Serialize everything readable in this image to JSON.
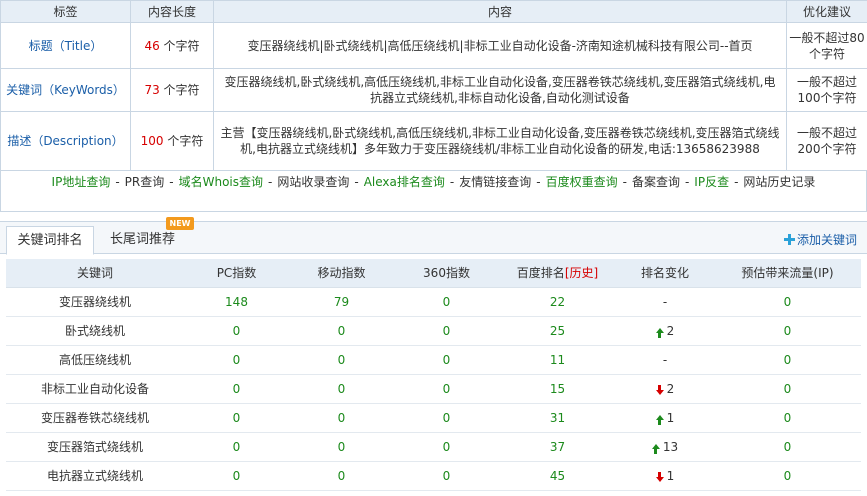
{
  "meta": {
    "headers": [
      "标签",
      "内容长度",
      "内容",
      "优化建议"
    ],
    "length_unit": "个字符",
    "rows": [
      {
        "label": "标题（Title）",
        "length": "46",
        "content": "变压器绕线机|卧式绕线机|高低压绕线机|非标工业自动化设备-济南知途机械科技有限公司--首页",
        "advice": "一般不超过80个字符"
      },
      {
        "label": "关键词（KeyWords）",
        "length": "73",
        "content": "变压器绕线机,卧式绕线机,高低压绕线机,非标工业自动化设备,变压器卷铁芯绕线机,变压器箔式绕线机,电抗器立式绕线机,非标自动化设备,自动化测试设备",
        "advice": "一般不超过100个字符"
      },
      {
        "label": "描述（Description）",
        "length": "100",
        "content": "主营【变压器绕线机,卧式绕线机,高低压绕线机,非标工业自动化设备,变压器卷铁芯绕线机,变压器箔式绕线机,电抗器立式绕线机】多年致力于变压器绕线机/非标工业自动化设备的研发,电话:13658623988",
        "advice": "一般不超过200个字符"
      }
    ]
  },
  "links": [
    {
      "text": "IP地址查询",
      "color": "green"
    },
    {
      "text": "PR查询",
      "color": "dark"
    },
    {
      "text": "域名Whois查询",
      "color": "green"
    },
    {
      "text": "网站收录查询",
      "color": "dark"
    },
    {
      "text": "Alexa排名查询",
      "color": "green"
    },
    {
      "text": "友情链接查询",
      "color": "dark"
    },
    {
      "text": "百度权重查询",
      "color": "green"
    },
    {
      "text": "备案查询",
      "color": "dark"
    },
    {
      "text": "IP反查",
      "color": "green"
    },
    {
      "text": "网站历史记录",
      "color": "dark"
    }
  ],
  "link_separator": "-",
  "tabs": {
    "active": "关键词排名",
    "second": "长尾词推荐",
    "badge": "NEW",
    "add_keyword": "添加关键词"
  },
  "rank": {
    "headers": {
      "keyword": "关键词",
      "pc": "PC指数",
      "mobile": "移动指数",
      "s360": "360指数",
      "baidu": "百度排名",
      "history": "[历史]",
      "change": "排名变化",
      "traffic": "预估带来流量(IP)"
    },
    "rows": [
      {
        "keyword": "变压器绕线机",
        "pc": "148",
        "mobile": "79",
        "s360": "0",
        "baidu": "22",
        "change_dir": "none",
        "change": "-",
        "traffic": "0"
      },
      {
        "keyword": "卧式绕线机",
        "pc": "0",
        "mobile": "0",
        "s360": "0",
        "baidu": "25",
        "change_dir": "up",
        "change": "2",
        "traffic": "0"
      },
      {
        "keyword": "高低压绕线机",
        "pc": "0",
        "mobile": "0",
        "s360": "0",
        "baidu": "11",
        "change_dir": "none",
        "change": "-",
        "traffic": "0"
      },
      {
        "keyword": "非标工业自动化设备",
        "pc": "0",
        "mobile": "0",
        "s360": "0",
        "baidu": "15",
        "change_dir": "down",
        "change": "2",
        "traffic": "0"
      },
      {
        "keyword": "变压器卷铁芯绕线机",
        "pc": "0",
        "mobile": "0",
        "s360": "0",
        "baidu": "31",
        "change_dir": "up",
        "change": "1",
        "traffic": "0"
      },
      {
        "keyword": "变压器箔式绕线机",
        "pc": "0",
        "mobile": "0",
        "s360": "0",
        "baidu": "37",
        "change_dir": "up",
        "change": "13",
        "traffic": "0"
      },
      {
        "keyword": "电抗器立式绕线机",
        "pc": "0",
        "mobile": "0",
        "s360": "0",
        "baidu": "45",
        "change_dir": "down",
        "change": "1",
        "traffic": "0"
      }
    ]
  },
  "colors": {
    "green": "#1c8a1c",
    "red": "#d60000",
    "blue": "#1a5ea8",
    "header_bg": "#e6eef6",
    "badge": "#f39a1d"
  }
}
